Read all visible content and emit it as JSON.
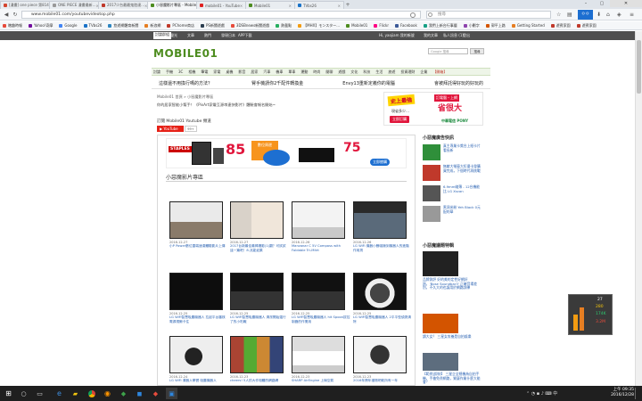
{
  "browser": {
    "tabs": [
      {
        "label": "[漫畫] one piece 第814...",
        "color": "#d4452f"
      },
      {
        "label": "ONE PIECE 漫畫最新...",
        "color": "#999999"
      },
      {
        "label": "2017少台最最鬼陸達...",
        "color": "#c0392b"
      },
      {
        "label": "小惡魔影片專區 - Mobile...",
        "color": "#4d8c1f",
        "active": true
      },
      {
        "label": "mobile01 - YouTube",
        "color": "#e02020"
      },
      {
        "label": "Mobile01",
        "color": "#4d8c1f"
      },
      {
        "label": "TVbs26",
        "color": "#1a73c8"
      }
    ],
    "url": "www.mobile01.com/youtubevideotop.php",
    "search_placeholder": "搜尋",
    "bookmarks": [
      {
        "label": "瞎趣時報",
        "color": "#e74c3c"
      },
      {
        "label": "Yahoo!奇摩",
        "color": "#720e9e"
      },
      {
        "label": "Google",
        "color": "#4285f4"
      },
      {
        "label": "TVbs26",
        "color": "#1a73c8"
      },
      {
        "label": "悠遊網體育新聞",
        "color": "#2e86c1"
      },
      {
        "label": "新浪網",
        "color": "#e67e22"
      },
      {
        "label": "PChome商店",
        "color": "#c0392b"
      },
      {
        "label": "PS新聞遊戲",
        "color": "#2c3e50"
      },
      {
        "label": "3DSBnews新聞遊戲",
        "color": "#e74c3c"
      },
      {
        "label": "熱載點",
        "color": "#27ae60"
      },
      {
        "label": "【MHX】モンスター...",
        "color": "#f39c12"
      },
      {
        "label": "Mobile01",
        "color": "#4d8c1f"
      },
      {
        "label": "Flickr",
        "color": "#ff0084"
      },
      {
        "label": "Facebook",
        "color": "#3b5998"
      },
      {
        "label": "我們上新台行事曆",
        "color": "#16a085"
      },
      {
        "label": "小劃字",
        "color": "#8e44ad"
      },
      {
        "label": "郭平上路",
        "color": "#d35400"
      },
      {
        "label": "Getting Started",
        "color": "#e67e22"
      },
      {
        "label": "遊賓家園",
        "color": "#c0392b"
      },
      {
        "label": "遊賓家園",
        "color": "#c0392b"
      }
    ]
  },
  "site": {
    "topnav": [
      "討論群組",
      "聲光",
      "文章",
      "熱門",
      "發現日本",
      "APP下載"
    ],
    "user_area": "Hi, yaojiam 我的帳號",
    "user_links": [
      "我的文章",
      "私人訊息 (1)",
      "登出"
    ],
    "logo": "MOBILE01",
    "search_placeholder": "Google 搜尋",
    "search_button": "搜尋",
    "menu": [
      "討論",
      "手機",
      "3C",
      "相機",
      "筆電",
      "家電",
      "桌機",
      "影音",
      "居家",
      "汽車",
      "機車",
      "單車",
      "運動",
      "時尚",
      "閒聊",
      "遊戲",
      "文化",
      "科技",
      "生活",
      "旅遊",
      "投資理財",
      "企業",
      "【開箱】"
    ],
    "topics": [
      "這樣還不用換行嗎的方法？",
      "腎手機請你2千配件轉換金",
      "Envy13重新定義你的電腦",
      "會被拜託得好玩的好玩的"
    ],
    "breadcrumb": "Mobile01 首頁 » 小惡魔影片專區",
    "subtitle": "你的居家智能小幫手！《PixArt家電互源串連快影片》體驗會報名開始~",
    "subscribe_label": "訂閱 Mobile01 Youtube 頻道",
    "youtube_button": "YouTube",
    "subscriber_count": "99+",
    "section_title": "小惡魔影片專區",
    "ad_banner": {
      "percent": "85",
      "percent2": "75",
      "button": "立即搶購",
      "brand": "STAPLES",
      "text": "數位周邊"
    },
    "videos": [
      {
        "date": "2016-12-27",
        "title": "小P Power數位雲端速達體驗影片上傳",
        "scene": "light"
      },
      {
        "date": "2016-12-27",
        "title": "2017台新最佳最棒攝影(1)翻？可試試這一篇吧！8.兆能如果",
        "scene": "person"
      },
      {
        "date": "2016-12-26",
        "title": "Manzanar C 5V Compass with Foldable Tri-Mitrt",
        "scene": "tripod"
      },
      {
        "date": "2016-12-26",
        "title": "LG WiFi 機器小騰嘯擁到機器人的進階作用測",
        "scene": "device"
      },
      {
        "date": "2016-12-25",
        "title": "LG WiFi智慧吸塵機器人 拉起平台審核電源視爾卡住",
        "scene": "dark"
      },
      {
        "date": "2016-12-25",
        "title": "LG WiFi智慧吸塵機器人 清潔開始運行了的小吃戰",
        "scene": "robot"
      },
      {
        "date": "2016-12-25",
        "title": "LG WiFi智慧吸塵機器人 hit Spoon拔控制器的作業用",
        "scene": "robot"
      },
      {
        "date": "2016-12-25",
        "title": "LG WiFi智慧吸塵機器人 2平平型偵測清除",
        "scene": "robot2"
      },
      {
        "date": "2016-12-24",
        "title": "LG WiFi 清器人學實 吸塵機器人",
        "scene": "robot3"
      },
      {
        "date": "2016-12-23",
        "title": "cheers! 5人的大作相體的網路網",
        "scene": "cheers"
      },
      {
        "date": "2016-12-23",
        "title": "SHARP AirEngine 上瑣空氣",
        "scene": "box"
      },
      {
        "date": "2016-12-23",
        "title": "2016年跨年禮物吧乾所有一年",
        "scene": "robot4"
      }
    ],
    "sidebar": {
      "ad_title": "史上最強",
      "ad_sub": "訂電腦・上網",
      "ad_big": "省很大",
      "ad_sub2": "現省多少…",
      "ad_button": "立即訂購",
      "ad_brand": "中華電信 PONY",
      "heading1": "小惡魔廣告快訊",
      "items1": [
        {
          "title": "真主專業卡獎台上紙卡片看長新",
          "color": "#2f8f3a"
        },
        {
          "title": "無敵大螢幕大紅優卡發購買完成，下個時代再挑戰",
          "color": "#c0392b"
        },
        {
          "title": "6.9mm縮薄 - 12台機能比 LG Xscan",
          "color": "#555555"
        },
        {
          "title": "黑洞米粉 Yeh Black 0元配的華",
          "color": "#999999"
        }
      ],
      "heading2": "小惡魔議題特輯",
      "items2": [
        {
          "title": "品牌測評 好的美的定性好網好過，'Bose Soundbar3' 正確音場差別，不久大的也讓用於網路訓練",
          "color": "#222222"
        },
        {
          "title": "讀大女？ 三星女攻養是自拍娛樂",
          "color": "#d35400"
        },
        {
          "title": "【範例]即刻】 三星企全總機為自拍手機，手槍免費網路，質疑作業什麼大能會？",
          "color": "#5d6d7e"
        }
      ]
    }
  },
  "net_widget": {
    "up": "27",
    "val1": "280",
    "val2": "174K",
    "val3": "3.2M"
  },
  "taskbar": {
    "time": "上午 09:35",
    "date": "2016/12/28"
  }
}
